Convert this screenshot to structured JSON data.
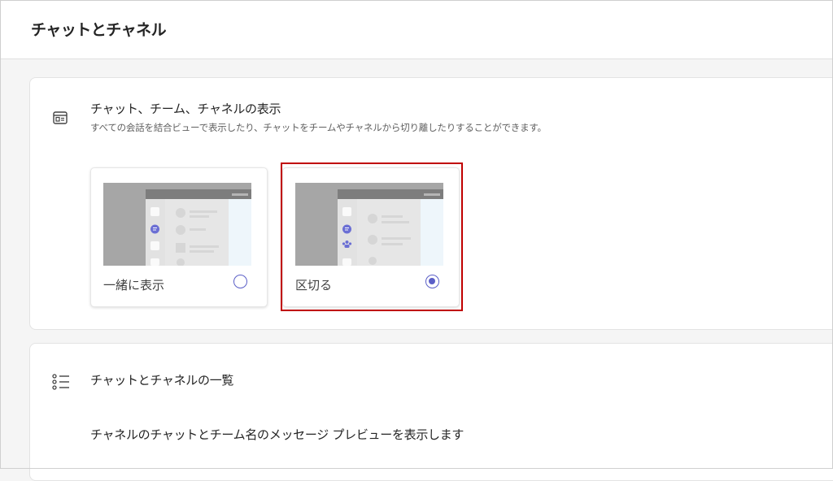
{
  "page": {
    "title": "チャットとチャネル"
  },
  "display_section": {
    "title": "チャット、チーム、チャネルの表示",
    "description": "すべての会話を結合ビューで表示したり、チャットをチームやチャネルから切り離したりすることができます。",
    "options": [
      {
        "label": "一緒に表示",
        "selected": false
      },
      {
        "label": "区切る",
        "selected": true
      }
    ],
    "accent_color": "#5b5fc7",
    "highlight_color": "#c00000"
  },
  "list_section": {
    "title": "チャットとチャネルの一覧",
    "setting_text": "チャネルのチャットとチーム名のメッセージ プレビューを表示します"
  }
}
